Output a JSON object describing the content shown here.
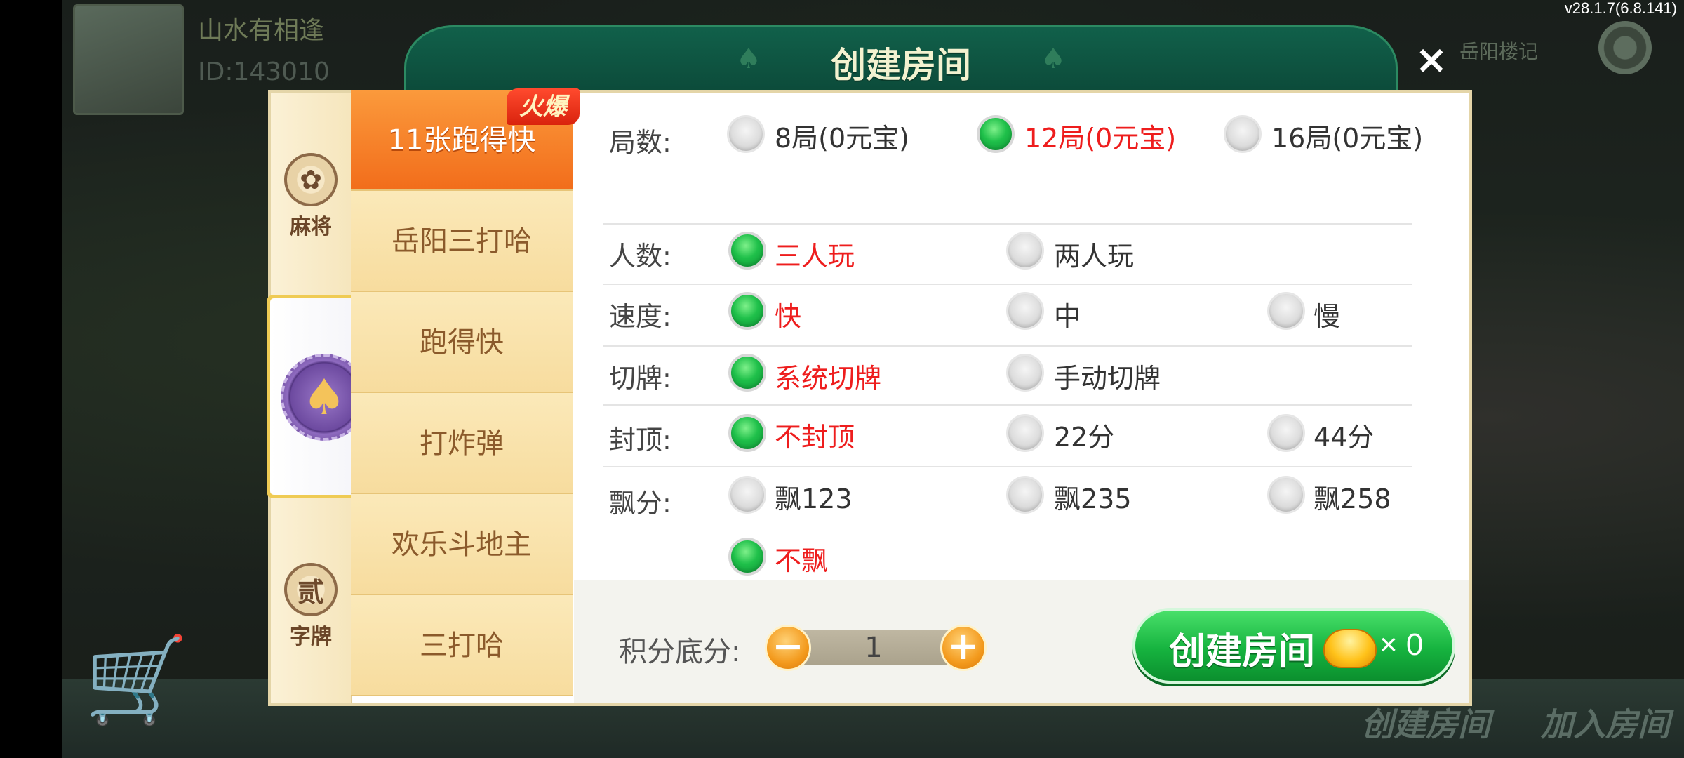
{
  "status": {
    "version": "v28.1.7(6.8.141)"
  },
  "background": {
    "player_name": "山水有相逢",
    "player_id": "ID:143010",
    "room_info": "岳阳楼记",
    "bottom_buttons": [
      "创建房间",
      "加入房间"
    ]
  },
  "dialog": {
    "title": "创建房间",
    "close_glyph": "×",
    "categories": [
      {
        "label": "麻将",
        "icon": "flower-badge-icon",
        "glyph": "✿"
      },
      {
        "label": "",
        "icon": "spade-badge-icon",
        "glyph": "♠"
      },
      {
        "label": "字牌",
        "icon": "er-badge-icon",
        "glyph": "贰"
      }
    ],
    "hot_badge": "火爆",
    "games": [
      "11张跑得快",
      "岳阳三打哈",
      "跑得快",
      "打炸弹",
      "欢乐斗地主",
      "三打哈"
    ],
    "selected_game": "11张跑得快",
    "options": [
      {
        "label": "局数:",
        "choices": [
          "8局(0元宝)",
          "12局(0元宝)",
          "16局(0元宝)"
        ],
        "selected": "12局(0元宝)"
      },
      {
        "label": "人数:",
        "choices": [
          "三人玩",
          "两人玩"
        ],
        "selected": "三人玩"
      },
      {
        "label": "速度:",
        "choices": [
          "快",
          "中",
          "慢"
        ],
        "selected": "快"
      },
      {
        "label": "切牌:",
        "choices": [
          "系统切牌",
          "手动切牌"
        ],
        "selected": "系统切牌"
      },
      {
        "label": "封顶:",
        "choices": [
          "不封顶",
          "22分",
          "44分"
        ],
        "selected": "不封顶"
      },
      {
        "label": "飘分:",
        "choices": [
          "飘123",
          "飘235",
          "飘258",
          "不飘"
        ],
        "selected": "不飘"
      }
    ],
    "base_score": {
      "label": "积分底分:",
      "value": "1",
      "minus": "−",
      "plus": "+"
    },
    "create_button": {
      "label": "创建房间",
      "cost": "× 0"
    }
  },
  "colors": {
    "accent_green": "#16b33f",
    "selected_text": "#ee1d1d",
    "header_green": "#0c4b3a",
    "tab_orange": "#f26d1b"
  }
}
